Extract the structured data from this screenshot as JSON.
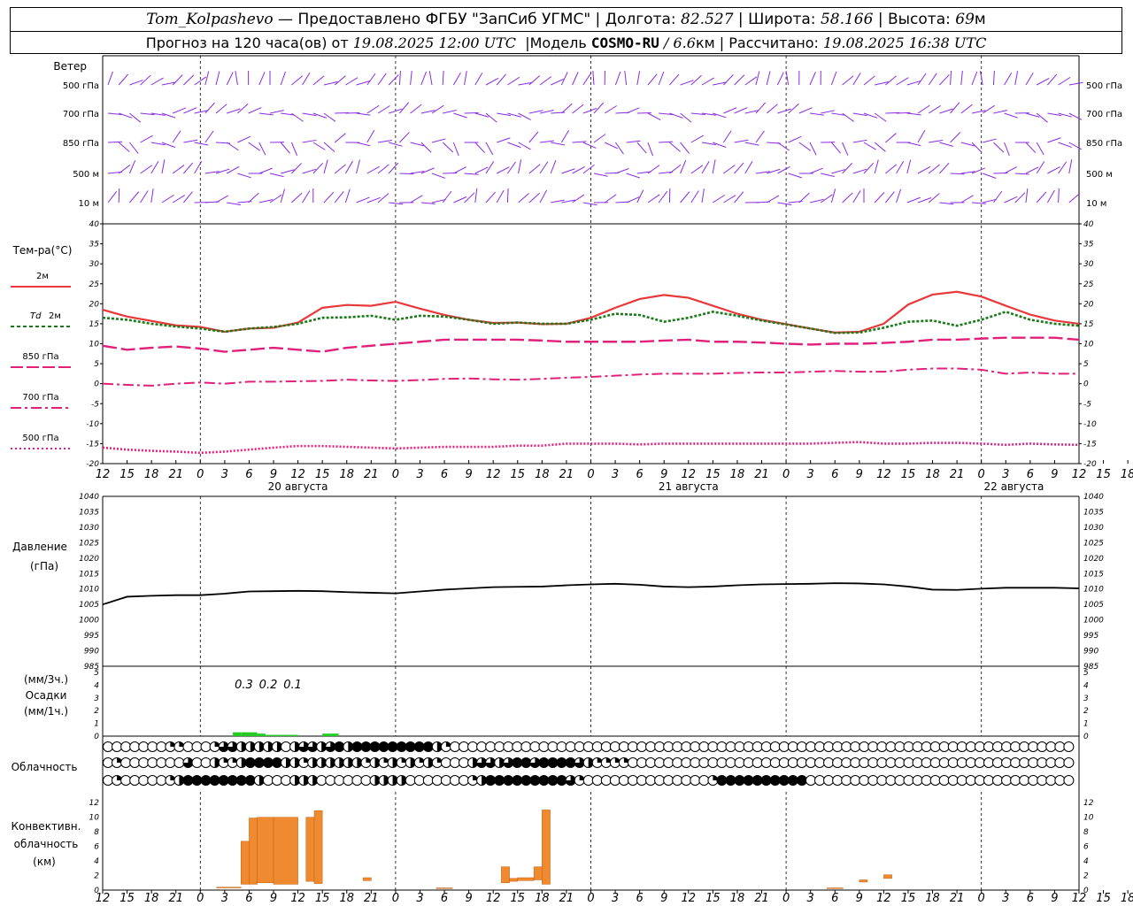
{
  "header": {
    "station": "Tom_Kolpashevo",
    "provider": "— Предоставлено ФГБУ \"ЗапСиб УГМС\"",
    "lon_label": "Долгота:",
    "lon_value": "82.527",
    "lat_label": "Широта:",
    "lat_value": "58.166",
    "alt_label": "Высота:",
    "alt_value": "69",
    "alt_unit": "м",
    "forecast_text": "Прогноз на 120 часа(ов) от",
    "forecast_from": "19.08.2025 12:00 UTC",
    "model_label": "Модель",
    "model_name": "COSMO-RU",
    "model_res": "/ 6.6",
    "model_res_unit": "км",
    "computed_label": "Рассчитано:",
    "computed_at": "19.08.2025 16:38 UTC",
    "sep": "|"
  },
  "labels": {
    "wind": "Ветер",
    "wind_levels": [
      "500 гПа",
      "700 гПа",
      "850 гПа",
      "500 м",
      "10  м"
    ],
    "temp_title": "Тем-ра(°С)",
    "temp_2m": "2м",
    "td_label": "Td",
    "td_2m": "2м",
    "t850": "850 гПа",
    "t700": "700 гПа",
    "t500": "500 гПа",
    "pressure": "Давление",
    "pressure_unit": "(гПа)",
    "precip_unit3": "(мм/3ч.)",
    "precip": "Осадки",
    "precip_unit1": "(мм/1ч.)",
    "cloud": "Облачность",
    "conv1": "Конвективн.",
    "conv2": "облачность",
    "conv3": "(км)",
    "dates": [
      "20 августа",
      "21 августа",
      "22 августа"
    ]
  },
  "colors": {
    "t2m": "#e8383a",
    "td": "#1a7a1a",
    "t850": "#e0207a",
    "t700": "#e0207a",
    "t500": "#e0207a",
    "wind": "#8a2be2",
    "pressure": "#000000",
    "precip": "#22cc22",
    "conv": "#f08a30"
  },
  "chart_data": [
    {
      "type": "line",
      "title": "Тем-ра(°С)",
      "x": [
        0,
        3,
        6,
        9,
        12,
        15,
        18,
        21,
        24,
        27,
        30,
        33,
        36,
        39,
        42,
        45,
        48,
        51,
        54,
        57,
        60,
        63,
        66,
        69,
        72,
        75,
        78,
        81,
        84,
        87,
        90,
        93,
        96,
        99,
        102,
        105,
        108,
        111,
        114,
        117,
        120
      ],
      "x_ticks": [
        "12",
        "15",
        "18",
        "21",
        "0",
        "3",
        "6",
        "9",
        "12",
        "15",
        "18",
        "21",
        "0",
        "3",
        "6",
        "9",
        "12",
        "15",
        "18",
        "21",
        "0",
        "3",
        "6",
        "9",
        "12",
        "15",
        "18",
        "21",
        "0",
        "3",
        "6",
        "9",
        "12",
        "15",
        "18",
        "21",
        "0",
        "3",
        "6",
        "9",
        "12",
        "15",
        "18"
      ],
      "ylim": [
        -20,
        40
      ],
      "yticks": [
        40,
        35,
        30,
        25,
        20,
        15,
        10,
        5,
        0,
        -5,
        -10,
        -15,
        -20
      ],
      "series": [
        {
          "name": "2м",
          "values": [
            18.5,
            16.8,
            15.7,
            14.6,
            14.2,
            13.0,
            13.8,
            14.0,
            15.3,
            19.0,
            19.7,
            19.5,
            20.5,
            18.8,
            17.2,
            16.0,
            15.2,
            15.3,
            14.9,
            15.0,
            16.5,
            19.0,
            21.2,
            22.2,
            21.5,
            19.5,
            17.5,
            16.0,
            14.9,
            13.8,
            12.8,
            13.0,
            15.0,
            19.8,
            22.3,
            23.0,
            21.8,
            19.5,
            17.3,
            15.8,
            15.0
          ]
        },
        {
          "name": "Td 2м",
          "values": [
            16.5,
            16.0,
            15.0,
            14.3,
            13.8,
            13.0,
            13.8,
            14.2,
            15.0,
            16.5,
            16.6,
            17.0,
            16.0,
            17.0,
            16.8,
            16.0,
            15.0,
            15.3,
            15.0,
            15.0,
            16.0,
            17.5,
            17.2,
            15.5,
            16.5,
            18.0,
            17.0,
            15.8,
            14.8,
            13.8,
            12.7,
            12.8,
            14.0,
            15.5,
            15.8,
            14.5,
            16.0,
            18.0,
            16.0,
            15.0,
            14.5
          ]
        },
        {
          "name": "850 гПа",
          "values": [
            9.5,
            8.5,
            9.0,
            9.3,
            8.8,
            8.0,
            8.5,
            9.0,
            8.5,
            8.0,
            9.0,
            9.5,
            10.0,
            10.5,
            11.0,
            11.0,
            11.0,
            11.0,
            10.8,
            10.5,
            10.5,
            10.5,
            10.5,
            10.8,
            11.0,
            10.5,
            10.5,
            10.3,
            10.0,
            9.8,
            10.0,
            10.0,
            10.2,
            10.5,
            11.0,
            11.0,
            11.3,
            11.5,
            11.5,
            11.5,
            11.0
          ]
        },
        {
          "name": "700 гПа",
          "values": [
            0.0,
            -0.3,
            -0.5,
            0.0,
            0.3,
            0.0,
            0.5,
            0.5,
            0.6,
            0.7,
            1.0,
            0.8,
            0.7,
            0.9,
            1.2,
            1.3,
            1.1,
            1.0,
            1.2,
            1.5,
            1.7,
            2.0,
            2.3,
            2.5,
            2.5,
            2.5,
            2.7,
            2.8,
            2.8,
            3.0,
            3.2,
            3.0,
            3.0,
            3.5,
            3.8,
            3.8,
            3.5,
            2.5,
            2.8,
            2.5,
            2.5
          ]
        },
        {
          "name": "500 гПа",
          "values": [
            -16.0,
            -16.5,
            -16.8,
            -17.0,
            -17.3,
            -17.0,
            -16.5,
            -16.0,
            -15.6,
            -15.6,
            -15.8,
            -16.0,
            -16.2,
            -16.0,
            -15.8,
            -15.8,
            -15.8,
            -15.5,
            -15.5,
            -15.0,
            -15.0,
            -15.0,
            -15.2,
            -15.0,
            -15.0,
            -15.0,
            -15.0,
            -15.0,
            -15.0,
            -15.0,
            -14.8,
            -14.6,
            -15.0,
            -15.0,
            -14.8,
            -14.8,
            -15.0,
            -15.3,
            -15.0,
            -15.2,
            -15.3
          ]
        }
      ]
    },
    {
      "type": "line",
      "title": "Давление",
      "ylabel": "(гПа)",
      "x": [
        0,
        3,
        6,
        9,
        12,
        15,
        18,
        21,
        24,
        27,
        30,
        33,
        36,
        39,
        42,
        45,
        48,
        51,
        54,
        57,
        60,
        63,
        66,
        69,
        72,
        75,
        78,
        81,
        84,
        87,
        90,
        93,
        96,
        99,
        102,
        105,
        108,
        111,
        114,
        117,
        120
      ],
      "ylim": [
        985,
        1040
      ],
      "yticks": [
        1040,
        1035,
        1030,
        1025,
        1020,
        1015,
        1010,
        1005,
        1000,
        995,
        990,
        985
      ],
      "values": [
        1005.0,
        1007.5,
        1007.8,
        1008.0,
        1008.0,
        1008.5,
        1009.2,
        1009.3,
        1009.4,
        1009.3,
        1009.0,
        1008.8,
        1008.6,
        1009.2,
        1009.8,
        1010.2,
        1010.6,
        1010.7,
        1010.8,
        1011.2,
        1011.5,
        1011.7,
        1011.4,
        1010.8,
        1010.6,
        1010.8,
        1011.2,
        1011.5,
        1011.6,
        1011.7,
        1011.9,
        1011.8,
        1011.5,
        1010.8,
        1009.8,
        1009.7,
        1010.1,
        1010.4,
        1010.4,
        1010.4,
        1010.2
      ]
    },
    {
      "type": "bar",
      "title": "Осадки",
      "ylabel": "(мм/3ч.) (мм/1ч.)",
      "ylim": [
        0,
        5
      ],
      "yticks": [
        5,
        4,
        3,
        2,
        1,
        0
      ],
      "bars": [
        {
          "hour": 16,
          "value": 0.3
        },
        {
          "hour": 17,
          "value": 0.3
        },
        {
          "hour": 18,
          "value": 0.3
        },
        {
          "hour": 19,
          "value": 0.2
        },
        {
          "hour": 20,
          "value": 0.1
        },
        {
          "hour": 21,
          "value": 0.1
        },
        {
          "hour": 22,
          "value": 0.1
        },
        {
          "hour": 23,
          "value": 0.1
        },
        {
          "hour": 27,
          "value": 0.2
        },
        {
          "hour": 28,
          "value": 0.2
        }
      ],
      "annotations": [
        {
          "hour": 18,
          "text": "0.3"
        },
        {
          "hour": 21,
          "text": "0.2"
        },
        {
          "hour": 24,
          "text": "0.1"
        }
      ]
    },
    {
      "type": "table",
      "title": "Облачность",
      "rows": [
        {
          "name": "upper",
          "values": [
            0,
            0,
            0,
            0,
            0,
            0,
            0,
            1,
            1,
            0,
            0,
            0,
            1,
            3,
            3,
            2,
            2,
            2,
            2,
            2,
            0,
            2,
            3,
            3,
            2,
            3,
            4,
            2,
            4,
            4,
            4,
            4,
            4,
            4,
            4,
            4,
            4,
            2,
            1,
            0,
            0,
            0,
            0,
            0,
            0,
            0,
            0,
            0,
            0,
            0,
            0,
            0,
            0,
            0,
            0,
            0,
            0,
            0,
            0,
            0,
            0,
            0,
            0,
            0,
            0,
            0,
            0,
            0,
            0,
            0,
            0,
            0,
            0,
            0,
            0,
            0,
            0,
            0,
            0,
            0,
            0,
            0,
            0,
            0,
            0,
            0,
            0,
            0,
            0,
            0,
            0,
            0,
            0,
            0,
            0,
            0,
            0,
            0,
            0,
            0,
            0,
            0,
            0,
            0,
            0,
            0,
            0,
            0,
            0,
            0,
            0,
            0,
            0,
            0,
            0,
            0,
            0,
            0,
            0,
            0,
            0
          ]
        },
        {
          "name": "middle",
          "values": [
            0,
            1,
            0,
            0,
            0,
            0,
            0,
            0,
            0,
            3,
            0,
            0,
            2,
            1,
            1,
            2,
            4,
            4,
            4,
            4,
            2,
            2,
            1,
            2,
            2,
            2,
            2,
            2,
            2,
            1,
            2,
            1,
            2,
            1,
            2,
            1,
            2,
            1,
            0,
            0,
            0,
            2,
            3,
            3,
            2,
            3,
            4,
            4,
            3,
            4,
            4,
            4,
            4,
            3,
            2,
            1,
            1,
            1,
            1,
            0,
            0,
            0,
            0,
            0,
            0,
            0,
            0,
            0,
            0,
            0,
            0,
            0,
            0,
            0,
            0,
            0,
            0,
            0,
            0,
            0,
            0,
            0,
            0,
            0,
            0,
            0,
            0,
            0,
            0,
            0,
            0,
            0,
            0,
            0,
            0,
            0,
            0,
            0,
            0,
            0,
            0,
            0,
            0,
            0,
            0,
            0,
            0,
            0,
            0,
            0,
            0,
            0,
            0,
            0,
            0,
            0,
            0,
            0,
            0,
            0,
            0
          ]
        },
        {
          "name": "lower",
          "values": [
            0,
            1,
            0,
            0,
            0,
            0,
            0,
            1,
            2,
            4,
            4,
            4,
            4,
            4,
            4,
            4,
            4,
            2,
            0,
            0,
            0,
            2,
            2,
            2,
            0,
            0,
            0,
            0,
            0,
            0,
            2,
            2,
            2,
            2,
            0,
            0,
            0,
            0,
            0,
            0,
            0,
            1,
            2,
            4,
            4,
            4,
            4,
            4,
            4,
            4,
            4,
            4,
            3,
            1,
            0,
            0,
            0,
            0,
            0,
            0,
            0,
            0,
            0,
            0,
            0,
            0,
            0,
            0,
            1,
            4,
            4,
            4,
            4,
            4,
            4,
            4,
            4,
            4,
            4,
            0,
            0,
            0,
            0,
            0,
            0,
            0,
            0,
            0,
            0,
            0,
            0,
            0,
            0,
            0,
            0,
            0,
            0,
            0,
            0,
            0,
            0,
            0,
            0,
            0,
            0,
            0,
            0,
            0,
            0,
            0,
            0,
            0,
            0,
            0,
            0,
            0,
            0,
            0,
            0,
            0,
            0
          ]
        }
      ]
    },
    {
      "type": "bar",
      "title": "Конвективн. облачность",
      "ylabel": "(км)",
      "ylim": [
        0,
        13
      ],
      "yticks": [
        12,
        10,
        8,
        6,
        4,
        2,
        0
      ],
      "bars": [
        {
          "from": 14,
          "to": 17,
          "base": 0.3,
          "top": 0.4
        },
        {
          "from": 17,
          "to": 18,
          "base": 0.8,
          "top": 6.7
        },
        {
          "from": 18,
          "to": 19,
          "base": 0.8,
          "top": 9.9
        },
        {
          "from": 19,
          "to": 21,
          "base": 1.0,
          "top": 10.0
        },
        {
          "from": 21,
          "to": 24,
          "base": 0.8,
          "top": 10.0
        },
        {
          "from": 25,
          "to": 26,
          "base": 1.2,
          "top": 10.0
        },
        {
          "from": 26,
          "to": 27,
          "base": 0.9,
          "top": 10.9
        },
        {
          "from": 32,
          "to": 33,
          "base": 1.3,
          "top": 1.7
        },
        {
          "from": 41,
          "to": 43,
          "base": 0.2,
          "top": 0.3
        },
        {
          "from": 49,
          "to": 50,
          "base": 1.0,
          "top": 3.2
        },
        {
          "from": 50,
          "to": 51,
          "base": 1.2,
          "top": 1.6
        },
        {
          "from": 51,
          "to": 53,
          "base": 1.3,
          "top": 1.7
        },
        {
          "from": 53,
          "to": 54,
          "base": 1.4,
          "top": 3.2
        },
        {
          "from": 54,
          "to": 55,
          "base": 0.8,
          "top": 11.0
        },
        {
          "from": 89,
          "to": 91,
          "base": 0.2,
          "top": 0.3
        },
        {
          "from": 93,
          "to": 94,
          "base": 1.1,
          "top": 1.4
        },
        {
          "from": 96,
          "to": 97,
          "base": 1.6,
          "top": 2.1
        }
      ]
    }
  ]
}
